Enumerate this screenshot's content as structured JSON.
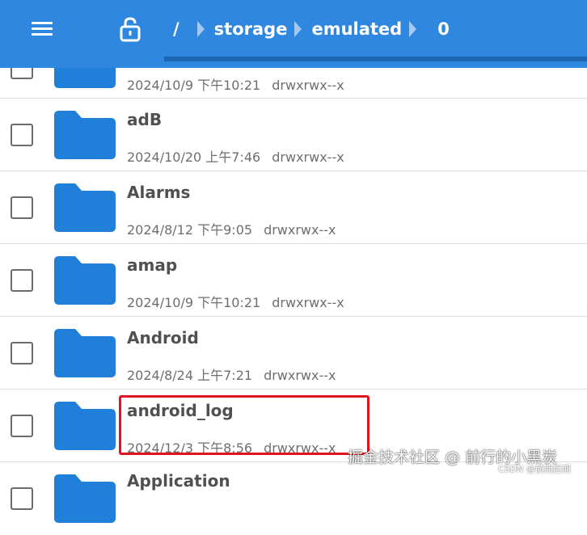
{
  "breadcrumb": {
    "root": "/",
    "segments": [
      "storage",
      "emulated",
      "0"
    ]
  },
  "toolbar": {
    "menu_icon": "menu-icon",
    "lock_icon": "lock-open-icon"
  },
  "files": [
    {
      "name": "",
      "date": "2024/10/9 下午10:21",
      "permissions": "drwxrwx--x"
    },
    {
      "name": "adB",
      "date": "2024/10/20 上午7:46",
      "permissions": "drwxrwx--x"
    },
    {
      "name": "Alarms",
      "date": "2024/8/12 下午9:05",
      "permissions": "drwxrwx--x"
    },
    {
      "name": "amap",
      "date": "2024/10/9 下午10:21",
      "permissions": "drwxrwx--x"
    },
    {
      "name": "Android",
      "date": "2024/8/24 上午7:21",
      "permissions": "drwxrwx--x"
    },
    {
      "name": "android_log",
      "date": "2024/12/3 下午8:56",
      "permissions": "drwxrwx--x"
    },
    {
      "name": "Application",
      "date": "",
      "permissions": ""
    }
  ],
  "colors": {
    "appbar": "#2f87df",
    "appbar_indicator": "#1d64b3",
    "folder": "#1f7fd9",
    "highlight": "#e0141e"
  },
  "watermark": {
    "main": "掘金技术社区 @ 前行的小黑炭",
    "small": "CSDN @前期后期"
  }
}
